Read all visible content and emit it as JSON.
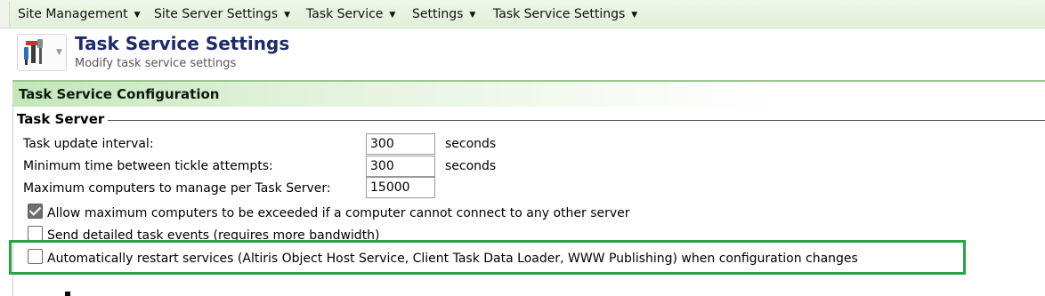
{
  "menu": {
    "items": [
      {
        "label": "Site Management"
      },
      {
        "label": "Site Server Settings"
      },
      {
        "label": "Task Service"
      },
      {
        "label": "Settings"
      },
      {
        "label": "Task Service Settings"
      }
    ],
    "caret_icon": "caret-down-icon"
  },
  "header": {
    "title": "Task Service Settings",
    "subtitle": "Modify task service settings",
    "icon": "tools-icon"
  },
  "section": {
    "title": "Task Service Configuration"
  },
  "task_server": {
    "legend": "Task Server",
    "fields": [
      {
        "label": "Task update interval:",
        "value": "300",
        "unit": "seconds"
      },
      {
        "label": "Minimum time between tickle attempts:",
        "value": "300",
        "unit": "seconds"
      },
      {
        "label": "Maximum computers to manage per Task Server:",
        "value": "15000",
        "unit": ""
      }
    ],
    "checkboxes": [
      {
        "label": "Allow maximum computers to be exceeded if a computer cannot connect to any other server",
        "checked": true
      },
      {
        "label": "Send detailed task events (requires more bandwidth)",
        "checked": false
      },
      {
        "label": "Automatically restart services (Altiris Object Host Service, Client Task Data Loader, WWW Publishing) when configuration changes",
        "checked": false
      }
    ]
  },
  "colors": {
    "title": "#1c2a6a",
    "section_header": "#c4e6b9",
    "highlight_border": "#2aa24a"
  }
}
